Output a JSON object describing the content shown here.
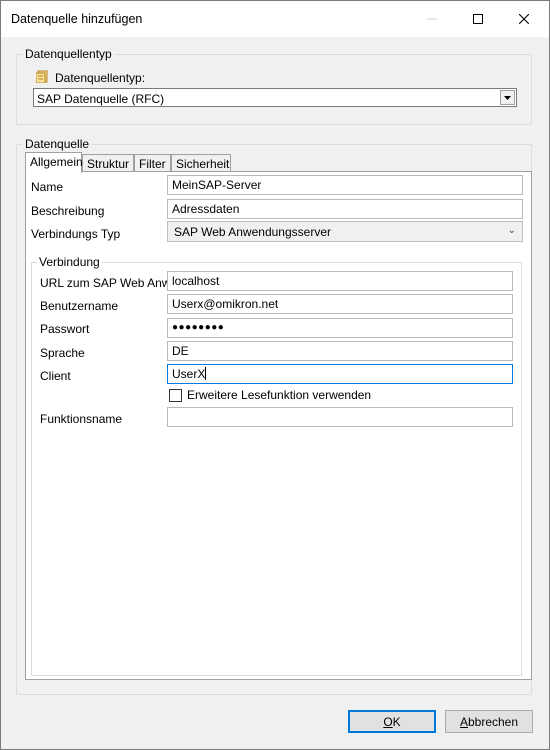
{
  "window": {
    "title": "Datenquelle hinzufügen"
  },
  "source_type_group": {
    "legend": "Datenquellentyp",
    "label": "Datenquellentyp:",
    "selected": "SAP Datenquelle (RFC)"
  },
  "datasource_group": {
    "legend": "Datenquelle",
    "tabs": [
      "Allgemein",
      "Struktur",
      "Filter",
      "Sicherheit"
    ],
    "fields": {
      "name_label": "Name",
      "name_value": "MeinSAP-Server",
      "description_label": "Beschreibung",
      "description_value": "Adressdaten",
      "conn_type_label": "Verbindungs Typ",
      "conn_type_value": "SAP Web Anwendungsserver"
    },
    "connection": {
      "legend": "Verbindung",
      "url_label": "URL zum SAP Web Anwe",
      "url_value": "localhost",
      "user_label": "Benutzername",
      "user_value": "Userx@omikron.net",
      "password_label": "Passwort",
      "password_value": "●●●●●●●●",
      "language_label": "Sprache",
      "language_value": "DE",
      "client_label": "Client",
      "client_value": "UserX",
      "extended_read_label": "Erweitere Lesefunktion verwenden",
      "extended_read_checked": false,
      "function_label": "Funktionsname",
      "function_value": ""
    }
  },
  "buttons": {
    "ok_mnemonic": "O",
    "ok_rest": "K",
    "cancel_mnemonic": "A",
    "cancel_rest": "bbrechen"
  }
}
